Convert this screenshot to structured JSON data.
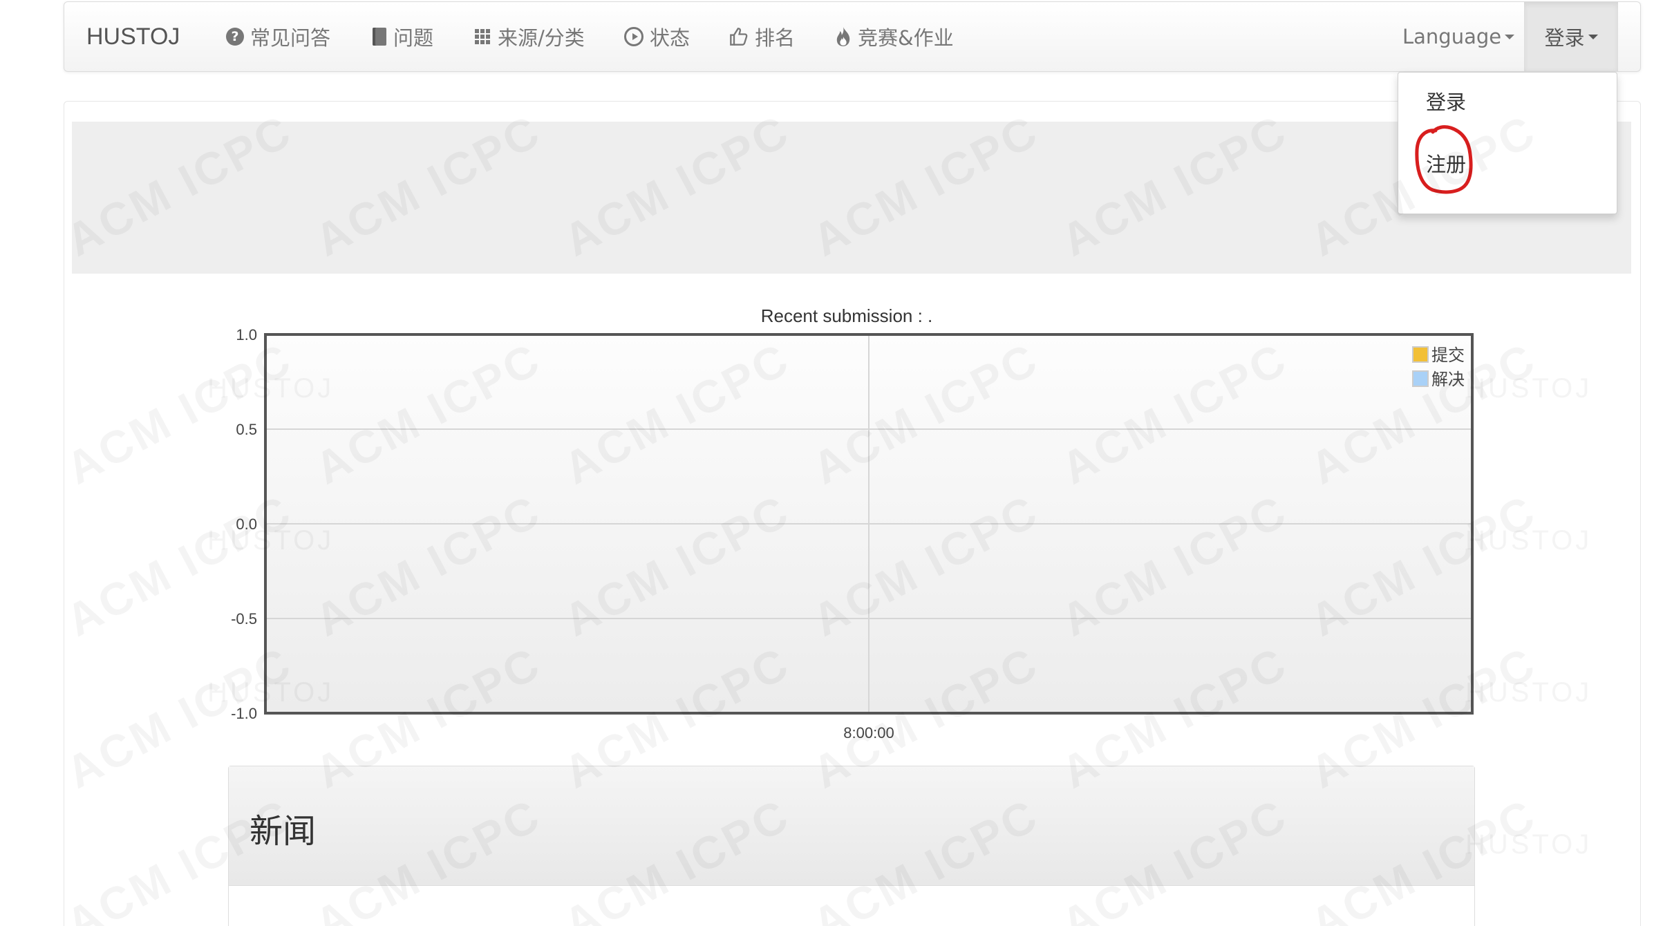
{
  "navbar": {
    "brand": "HUSTOJ",
    "items": [
      {
        "label": "常见问答",
        "icon": "question-circle-icon"
      },
      {
        "label": "问题",
        "icon": "book-icon"
      },
      {
        "label": "来源/分类",
        "icon": "grid-icon"
      },
      {
        "label": "状态",
        "icon": "play-circle-icon"
      },
      {
        "label": "排名",
        "icon": "thumbs-up-icon"
      },
      {
        "label": "竞赛&作业",
        "icon": "fire-icon"
      }
    ],
    "language_label": "Language",
    "login_label": "登录"
  },
  "dropdown": {
    "items": [
      "登录",
      "注册"
    ],
    "highlight_color": "#d81e1e"
  },
  "chart_data": {
    "type": "line",
    "title": "Recent submission : .",
    "x": [
      "8:00:00"
    ],
    "ylim": [
      -1.0,
      1.0
    ],
    "yticks": [
      "1.0",
      "0.5",
      "0.0",
      "-0.5",
      "-1.0"
    ],
    "grid": true,
    "legend_position": "top-right",
    "series": [
      {
        "name": "提交",
        "color": "#f2c037",
        "values": []
      },
      {
        "name": "解决",
        "color": "#a9d1f7",
        "values": []
      }
    ]
  },
  "news": {
    "title": "新闻"
  },
  "watermark": {
    "text_main": "ACM ICPC",
    "text_small": "HUSTOJ"
  }
}
